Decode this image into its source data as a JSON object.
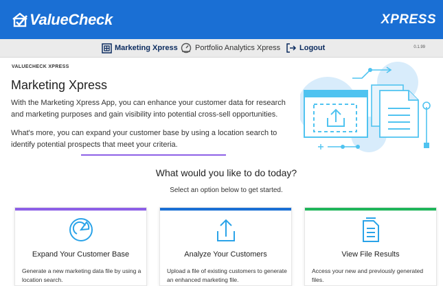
{
  "app": {
    "brand": "ValueCheck",
    "product": "XPRESS",
    "version": "0.1.99"
  },
  "nav": {
    "items": [
      {
        "label": "Marketing Xpress",
        "icon": "marketing-icon"
      },
      {
        "label": "Portfolio Analytics Xpress",
        "icon": "portfolio-icon"
      },
      {
        "label": "Logout",
        "icon": "logout-icon"
      }
    ]
  },
  "page": {
    "breadcrumb": "VALUECHECK XPRESS",
    "title": "Marketing Xpress",
    "intro_1": "With the Marketing Xpress App, you can enhance your customer data for research and marketing purposes and gain visibility into potential cross-sell opportunities.",
    "intro_2": "What's more, you can expand your customer base by using a location search to identify potential prospects that meet your criteria.",
    "question": "What would you like to do today?",
    "subtitle": "Select an option below to get started."
  },
  "cards": [
    {
      "title": "Expand Your Customer Base",
      "desc": "Generate a new marketing data file by using a location search.",
      "accent": "#8d5fe6",
      "icon": "chart-pie-icon"
    },
    {
      "title": "Analyze Your Customers",
      "desc": "Upload a file of existing customers to generate an enhanced marketing file.",
      "accent": "#1a6fd4",
      "icon": "upload-icon"
    },
    {
      "title": "View File Results",
      "desc": "Access your new and previously generated files.",
      "accent": "#1fb55a",
      "icon": "document-icon"
    }
  ],
  "colors": {
    "brand_blue": "#1a6fd4",
    "purple": "#8d5fe6",
    "green": "#1fb55a",
    "light_blue": "#4fc3f0"
  }
}
